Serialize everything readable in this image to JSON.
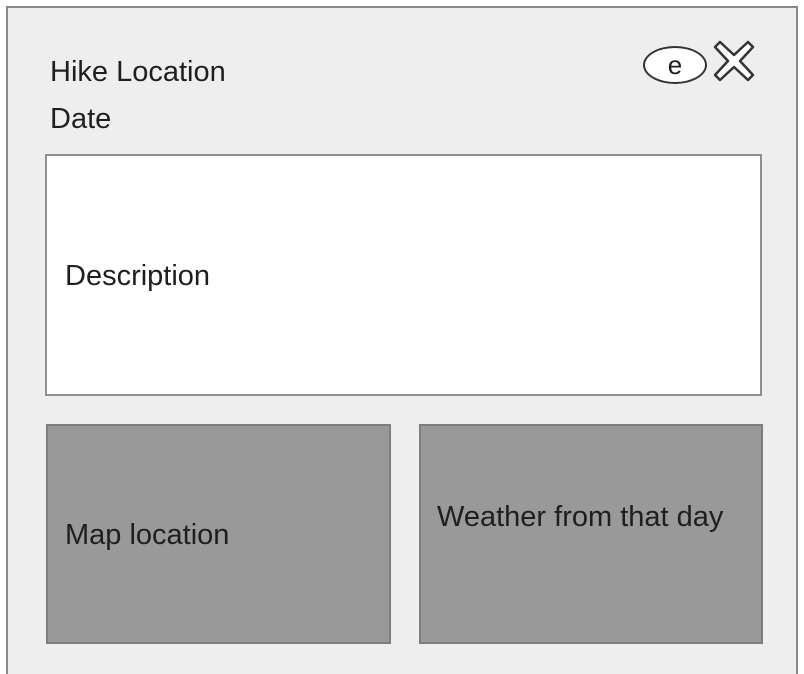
{
  "header": {
    "title": "Hike Location",
    "date_label": "Date",
    "edit_label": "e",
    "close_icon": "close-x-icon"
  },
  "description": {
    "label": "Description"
  },
  "panels": {
    "map_label": "Map location",
    "weather_label": "Weather from that day"
  },
  "colors": {
    "card_background": "#eeeeee",
    "panel_background": "#999999",
    "description_background": "#ffffff"
  }
}
